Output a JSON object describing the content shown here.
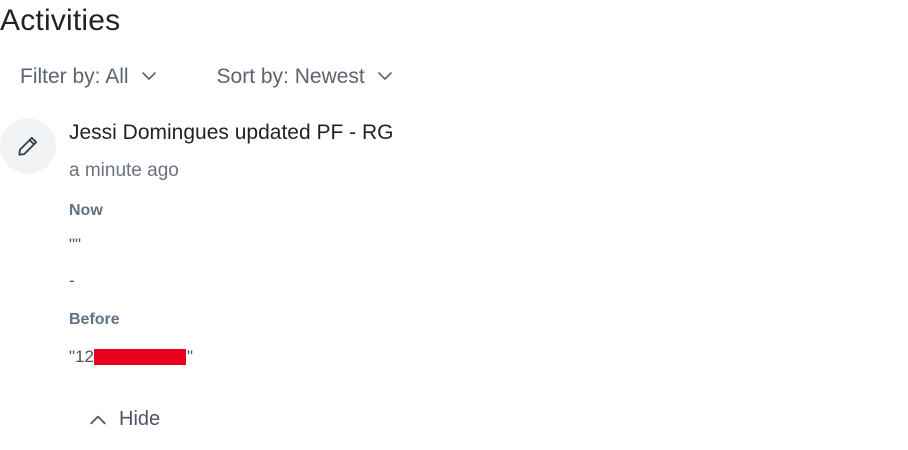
{
  "header": {
    "title": "Activities"
  },
  "filters": {
    "filter_label": "Filter by: All",
    "sort_label": "Sort by: Newest"
  },
  "activity": {
    "icon": "pencil-icon",
    "title": "Jessi Domingues updated PF - RG",
    "time": "a minute ago",
    "now_label": "Now",
    "now_value_1": "\"\"",
    "now_value_2": "-",
    "before_label": "Before",
    "before_value_prefix": "\"12",
    "before_value_suffix": "\"",
    "hide_label": "Hide"
  },
  "colors": {
    "redaction": "#e8001c",
    "section_label": "#5e7387"
  }
}
